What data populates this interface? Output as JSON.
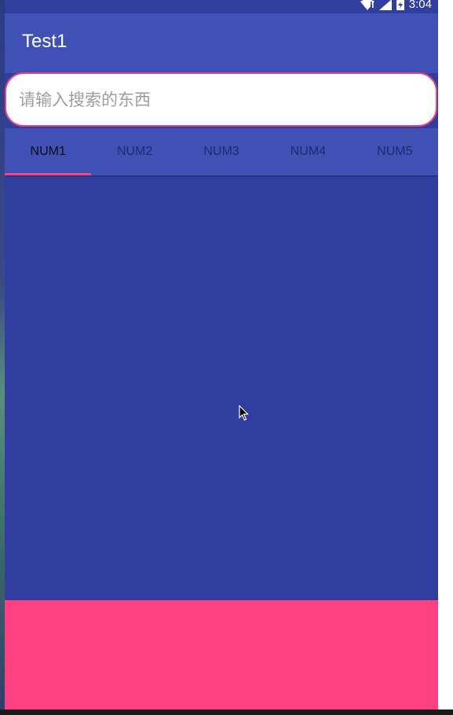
{
  "status_bar": {
    "time": "3:04",
    "icons": [
      "wifi-icon",
      "signal-icon",
      "battery-charging-icon"
    ]
  },
  "app_bar": {
    "title": "Test1"
  },
  "search": {
    "placeholder": "请输入搜索的东西",
    "value": ""
  },
  "tabs": [
    {
      "label": "NUM1",
      "selected": true
    },
    {
      "label": "NUM2",
      "selected": false
    },
    {
      "label": "NUM3",
      "selected": false
    },
    {
      "label": "NUM4",
      "selected": false
    },
    {
      "label": "NUM5",
      "selected": false
    }
  ],
  "colors": {
    "primary": "#3f51b5",
    "primary_dark": "#303f9f",
    "accent": "#ff4081"
  }
}
